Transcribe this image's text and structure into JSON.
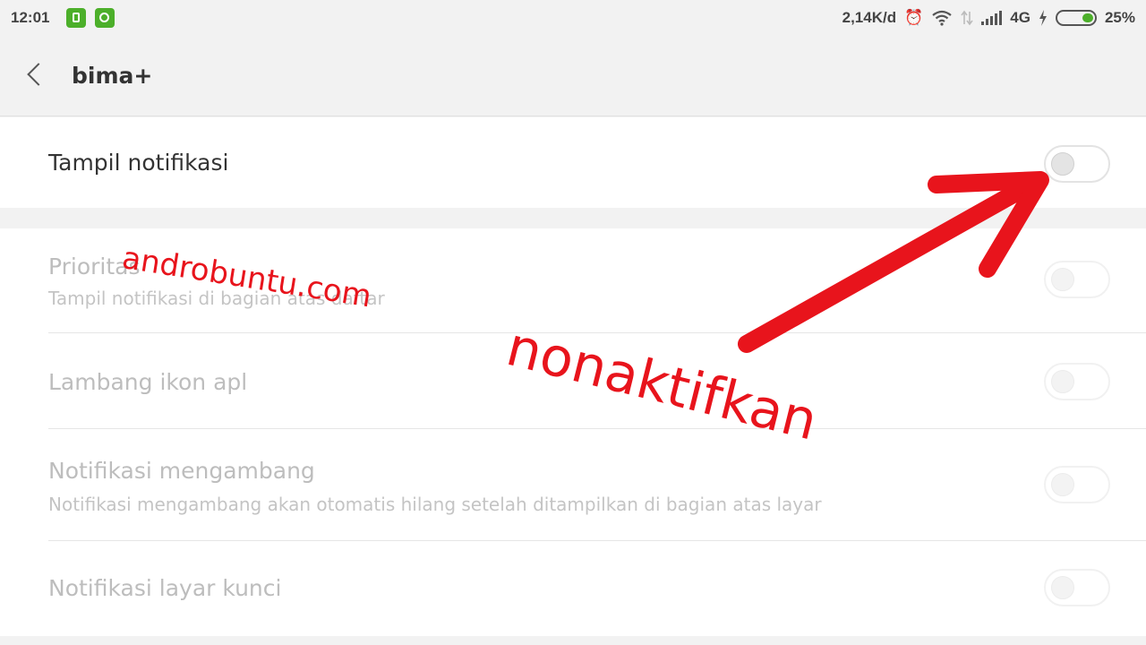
{
  "status_bar": {
    "time": "12:01",
    "speed": "2,14K/d",
    "network": "4G",
    "battery": "25%",
    "icons": [
      "app-notification-icon",
      "chat-notification-icon",
      "alarm-icon",
      "wifi-icon",
      "data-arrows-icon",
      "signal-icon",
      "charging-icon",
      "battery-icon"
    ],
    "accent_color": "#4caf2a"
  },
  "app_bar": {
    "back_icon": "chevron-left-icon",
    "title": "bima+"
  },
  "settings": {
    "show_notifications": {
      "label": "Tampil notifikasi",
      "enabled": false
    },
    "items": [
      {
        "label": "Prioritas",
        "subtitle": "Tampil notifikasi di bagian atas daftar",
        "enabled": false
      },
      {
        "label": "Lambang ikon apl",
        "enabled": false
      },
      {
        "label": "Notifikasi mengambang",
        "subtitle": "Notifikasi mengambang akan otomatis hilang setelah ditampilkan di bagian atas layar",
        "enabled": false
      },
      {
        "label": "Notifikasi layar kunci",
        "enabled": false
      }
    ]
  },
  "annotations": {
    "watermark": "androbuntu.com",
    "instruction": "nonaktifkan",
    "color": "#e8141c"
  }
}
